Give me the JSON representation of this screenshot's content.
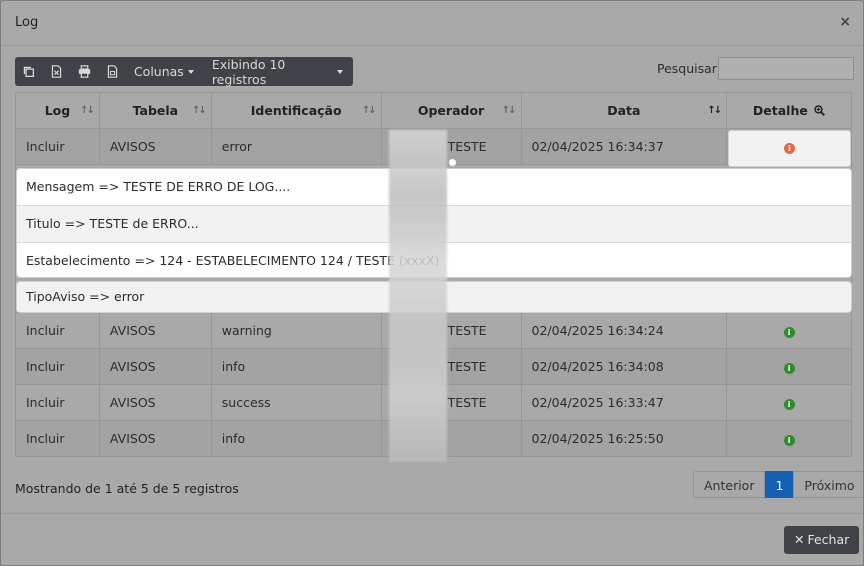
{
  "modal": {
    "title": "Log",
    "close_glyph": "×"
  },
  "toolbar": {
    "buttons": [
      {
        "icon": "copy-icon"
      },
      {
        "icon": "excel-icon"
      },
      {
        "icon": "print-icon"
      },
      {
        "icon": "pdf-icon"
      }
    ],
    "columns_label": "Colunas",
    "rows_label": "Exibindo 10 registros"
  },
  "search": {
    "label": "Pesquisar",
    "value": ""
  },
  "table": {
    "headers": [
      "Log",
      "Tabela",
      "Identificação",
      "Operador",
      "Data",
      "Detalhe"
    ],
    "rows": [
      {
        "log": "Incluir",
        "tabela": "AVISOS",
        "identificacao": "error",
        "operador": "TESTE",
        "data": "02/04/2025 16:34:37",
        "status": "red"
      },
      {
        "log": "Incluir",
        "tabela": "AVISOS",
        "identificacao": "warning",
        "operador": "TESTE",
        "data": "02/04/2025 16:34:24",
        "status": "green"
      },
      {
        "log": "Incluir",
        "tabela": "AVISOS",
        "identificacao": "info",
        "operador": "TESTE",
        "data": "02/04/2025 16:34:08",
        "status": "green"
      },
      {
        "log": "Incluir",
        "tabela": "AVISOS",
        "identificacao": "success",
        "operador": "TESTE",
        "data": "02/04/2025 16:33:47",
        "status": "green"
      },
      {
        "log": "Incluir",
        "tabela": "AVISOS",
        "identificacao": "info",
        "operador": "",
        "data": "02/04/2025 16:25:50",
        "status": "green"
      }
    ]
  },
  "detail": {
    "items": [
      "Mensagem => TESTE DE ERRO DE LOG....",
      "Titulo => TESTE de ERRO...",
      "Estabelecimento => 124 - ESTABELECIMENTO 124 / TESTE (xxxX)"
    ],
    "extra": "TipoAviso => error"
  },
  "footer": {
    "info": "Mostrando de 1 até 5 de 5 registros",
    "prev": "Anterior",
    "page": "1",
    "next": "Próximo",
    "close_label": "Fechar"
  },
  "colors": {
    "status_red": "#e06a4b",
    "status_green": "#2e8b2e",
    "page_active": "#1460b0"
  }
}
